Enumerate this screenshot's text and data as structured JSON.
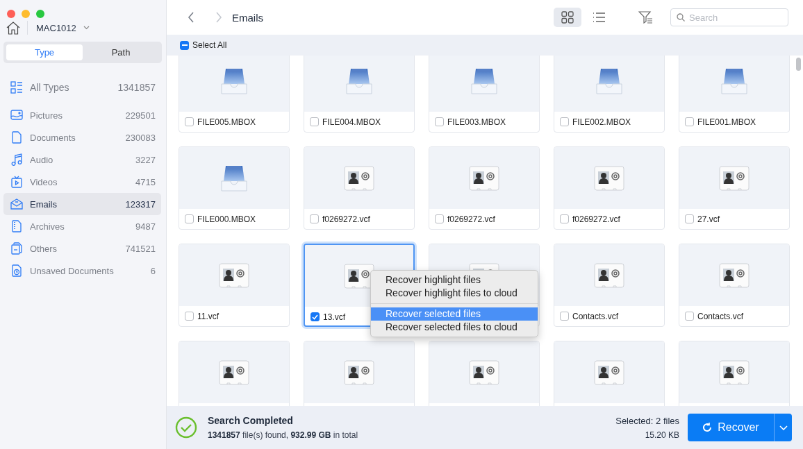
{
  "sidebar": {
    "device": "MAC1012",
    "tabs": [
      {
        "label": "Type",
        "selected": true
      },
      {
        "label": "Path",
        "selected": false
      }
    ],
    "items": [
      {
        "label": "All Types",
        "count": "1341857",
        "selected": false
      },
      {
        "label": "Pictures",
        "count": "229501",
        "selected": false
      },
      {
        "label": "Documents",
        "count": "230083",
        "selected": false
      },
      {
        "label": "Audio",
        "count": "3227",
        "selected": false
      },
      {
        "label": "Videos",
        "count": "4715",
        "selected": false
      },
      {
        "label": "Emails",
        "count": "123317",
        "selected": true
      },
      {
        "label": "Archives",
        "count": "9487",
        "selected": false
      },
      {
        "label": "Others",
        "count": "741521",
        "selected": false
      },
      {
        "label": "Unsaved Documents",
        "count": "6",
        "selected": false
      }
    ]
  },
  "toolbar": {
    "title": "Emails",
    "views": [
      {
        "selected": true
      },
      {
        "selected": false
      }
    ],
    "search": {
      "placeholder": "Search"
    }
  },
  "select_all": {
    "label": "Select All",
    "indeterminate": true
  },
  "cards": [
    {
      "kind": "mbox",
      "name": "FILE005.MBOX",
      "checked": false,
      "selected": false
    },
    {
      "kind": "mbox",
      "name": "FILE004.MBOX",
      "checked": false,
      "selected": false
    },
    {
      "kind": "mbox",
      "name": "FILE003.MBOX",
      "checked": false,
      "selected": false
    },
    {
      "kind": "mbox",
      "name": "FILE002.MBOX",
      "checked": false,
      "selected": false
    },
    {
      "kind": "mbox",
      "name": "FILE001.MBOX",
      "checked": false,
      "selected": false
    },
    {
      "kind": "mbox",
      "name": "FILE000.MBOX",
      "checked": false,
      "selected": false
    },
    {
      "kind": "vcf",
      "name": "f0269272.vcf",
      "checked": false,
      "selected": false
    },
    {
      "kind": "vcf",
      "name": "f0269272.vcf",
      "checked": false,
      "selected": false
    },
    {
      "kind": "vcf",
      "name": "f0269272.vcf",
      "checked": false,
      "selected": false
    },
    {
      "kind": "vcf",
      "name": "27.vcf",
      "checked": false,
      "selected": false
    },
    {
      "kind": "vcf",
      "name": "11.vcf",
      "checked": false,
      "selected": false
    },
    {
      "kind": "vcf",
      "name": "13.vcf",
      "checked": true,
      "selected": true
    },
    {
      "kind": "vcf",
      "selected": false
    },
    {
      "kind": "vcf",
      "name": "Contacts.vcf",
      "checked": false,
      "selected": false
    },
    {
      "kind": "vcf",
      "name": "Contacts.vcf",
      "checked": false,
      "selected": false
    },
    {
      "kind": "vcf",
      "selected": false
    },
    {
      "kind": "vcf",
      "selected": false
    },
    {
      "kind": "vcf",
      "selected": false
    },
    {
      "kind": "vcf",
      "selected": false
    },
    {
      "kind": "vcf",
      "selected": false
    }
  ],
  "context_menu": {
    "groups": [
      [
        {
          "label": "Recover highlight files",
          "selected": false
        },
        {
          "label": "Recover highlight files to cloud",
          "selected": false
        }
      ],
      [
        {
          "label": "Recover selected files",
          "selected": true
        },
        {
          "label": "Recover selected files to cloud",
          "selected": false
        }
      ]
    ]
  },
  "status": {
    "title": "Search Completed",
    "summary": "**1341857** file(s) found, **932.99 GB** in total",
    "selected": "Selected: 2 files",
    "size": "15.20 KB",
    "button": "Recover"
  }
}
